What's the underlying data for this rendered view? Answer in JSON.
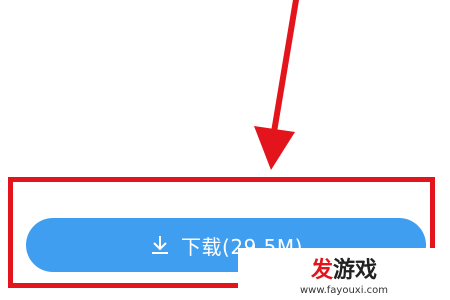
{
  "download_button": {
    "label": "下载(29.5M)",
    "icon": "download-arrow-icon",
    "color": "#3f9ef0"
  },
  "annotation": {
    "color": "#e3141b",
    "arrow_icon": "pointer-arrow-icon"
  },
  "watermark": {
    "brand_first": "发",
    "brand_rest": "游戏",
    "url": "www.fayouxi.com"
  }
}
